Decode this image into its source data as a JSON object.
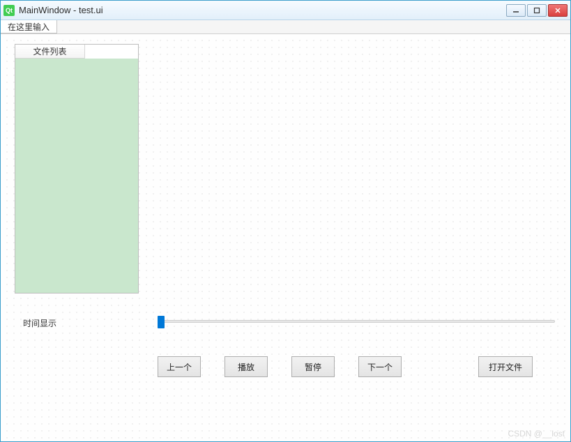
{
  "window": {
    "title": "MainWindow - test.ui",
    "icon_label": "Qt"
  },
  "menubar": {
    "item1": "在这里输入"
  },
  "file_list": {
    "header": "文件列表"
  },
  "time": {
    "label": "时间显示"
  },
  "slider": {
    "value": 0,
    "min": 0,
    "max": 100
  },
  "buttons": {
    "prev": "上一个",
    "play": "播放",
    "pause": "暂停",
    "next": "下一个",
    "open": "打开文件"
  },
  "watermark": "CSDN @__lost"
}
